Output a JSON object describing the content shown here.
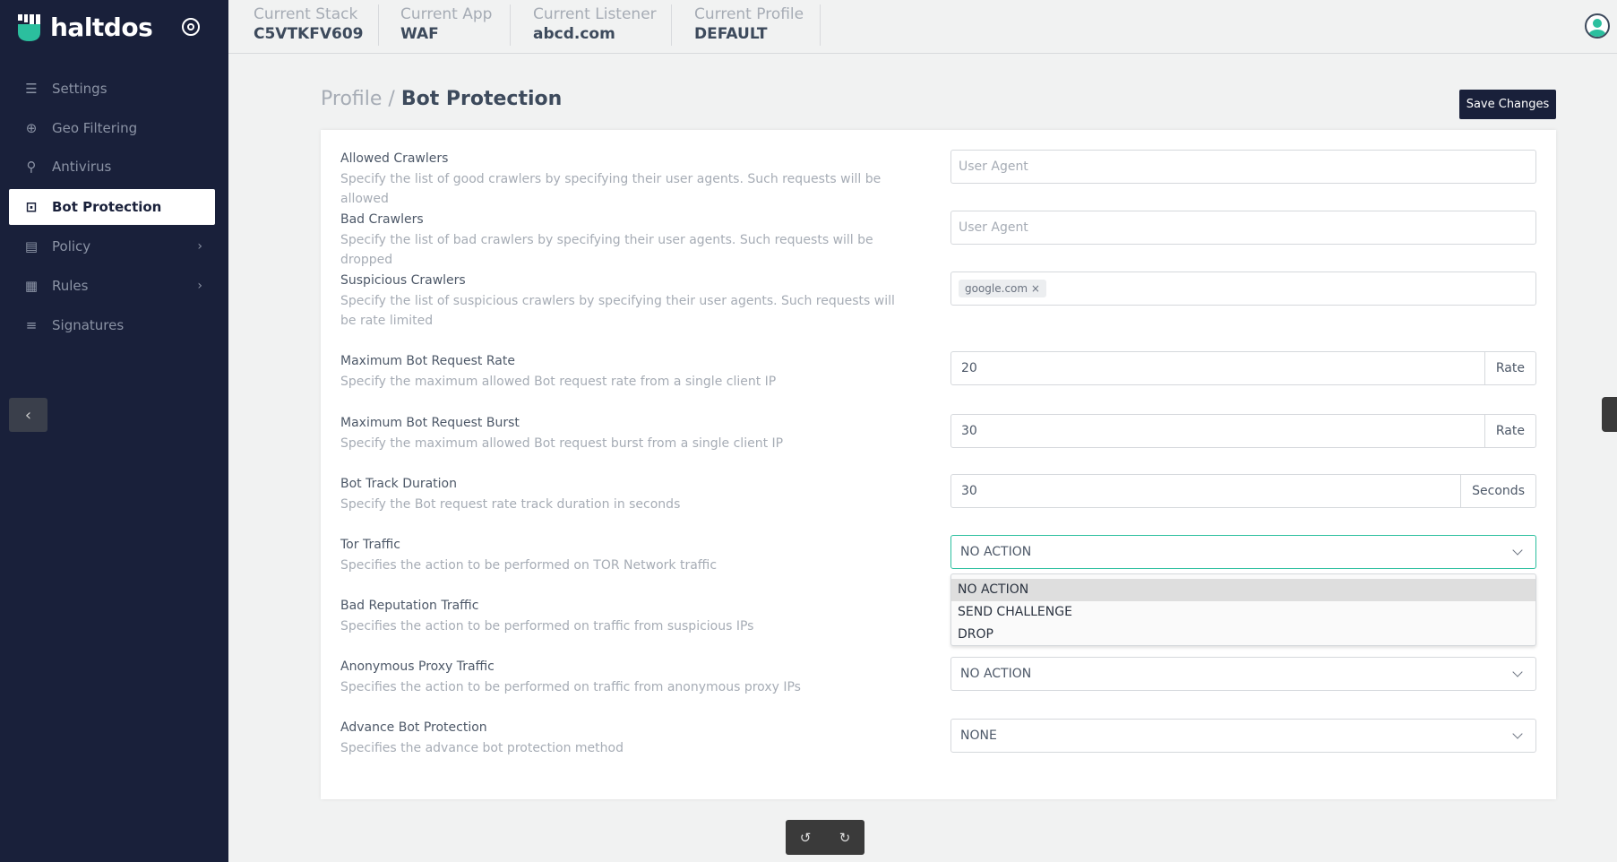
{
  "brand": {
    "name": "haltdos",
    "accent": "#2bbf9e",
    "sidebar_bg": "#19203a"
  },
  "sidebar": {
    "items": [
      {
        "label": "Settings",
        "icon": "sliders-icon"
      },
      {
        "label": "Geo Filtering",
        "icon": "globe-icon"
      },
      {
        "label": "Antivirus",
        "icon": "search-icon"
      },
      {
        "label": "Bot Protection",
        "icon": "robot-icon",
        "active": true
      },
      {
        "label": "Policy",
        "icon": "archive-icon",
        "has_children": true
      },
      {
        "label": "Rules",
        "icon": "list-box-icon",
        "has_children": true
      },
      {
        "label": "Signatures",
        "icon": "list-icon"
      }
    ]
  },
  "header": {
    "items": [
      {
        "label": "Current Stack",
        "value": "C5VTKFV609"
      },
      {
        "label": "Current App",
        "value": "WAF"
      },
      {
        "label": "Current Listener",
        "value": "abcd.com"
      },
      {
        "label": "Current Profile",
        "value": "DEFAULT"
      }
    ]
  },
  "page": {
    "crumb": "Profile",
    "separator": "/",
    "title": "Bot Protection",
    "save_label": "Save Changes"
  },
  "form": {
    "allowed": {
      "label": "Allowed Crawlers",
      "desc": "Specify the list of good crawlers by specifying their user agents. Such requests will be allowed",
      "placeholder": "User Agent"
    },
    "bad": {
      "label": "Bad Crawlers",
      "desc": "Specify the list of bad crawlers by specifying their user agents. Such requests will be dropped",
      "placeholder": "User Agent"
    },
    "suspicious": {
      "label": "Suspicious Crawlers",
      "desc": "Specify the list of suspicious crawlers by specifying their user agents. Such requests will be rate limited",
      "tags": [
        "google.com"
      ],
      "tag_remove": "×"
    },
    "rate": {
      "label": "Maximum Bot Request Rate",
      "desc": "Specify the maximum allowed Bot request rate from a single client IP",
      "value": "20",
      "unit": "Rate"
    },
    "burst": {
      "label": "Maximum Bot Request Burst",
      "desc": "Specify the maximum allowed Bot request burst from a single client IP",
      "value": "30",
      "unit": "Rate"
    },
    "track": {
      "label": "Bot Track Duration",
      "desc": "Specify the Bot request rate track duration in seconds",
      "value": "30",
      "unit": "Seconds"
    },
    "tor": {
      "label": "Tor Traffic",
      "desc": "Specifies the action to be performed on TOR Network traffic",
      "value": "NO ACTION",
      "options": [
        "NO ACTION",
        "SEND CHALLENGE",
        "DROP"
      ]
    },
    "reputation": {
      "label": "Bad Reputation Traffic",
      "desc": "Specifies the action to be performed on traffic from suspicious IPs"
    },
    "proxy": {
      "label": "Anonymous Proxy Traffic",
      "desc": "Specifies the action to be performed on traffic from anonymous proxy IPs",
      "value": "NO ACTION"
    },
    "advance": {
      "label": "Advance Bot Protection",
      "desc": "Specifies the advance bot protection method",
      "value": "NONE"
    }
  },
  "toolbar": {
    "undo_icon": "rotate-left-icon",
    "redo_icon": "rotate-right-icon"
  }
}
